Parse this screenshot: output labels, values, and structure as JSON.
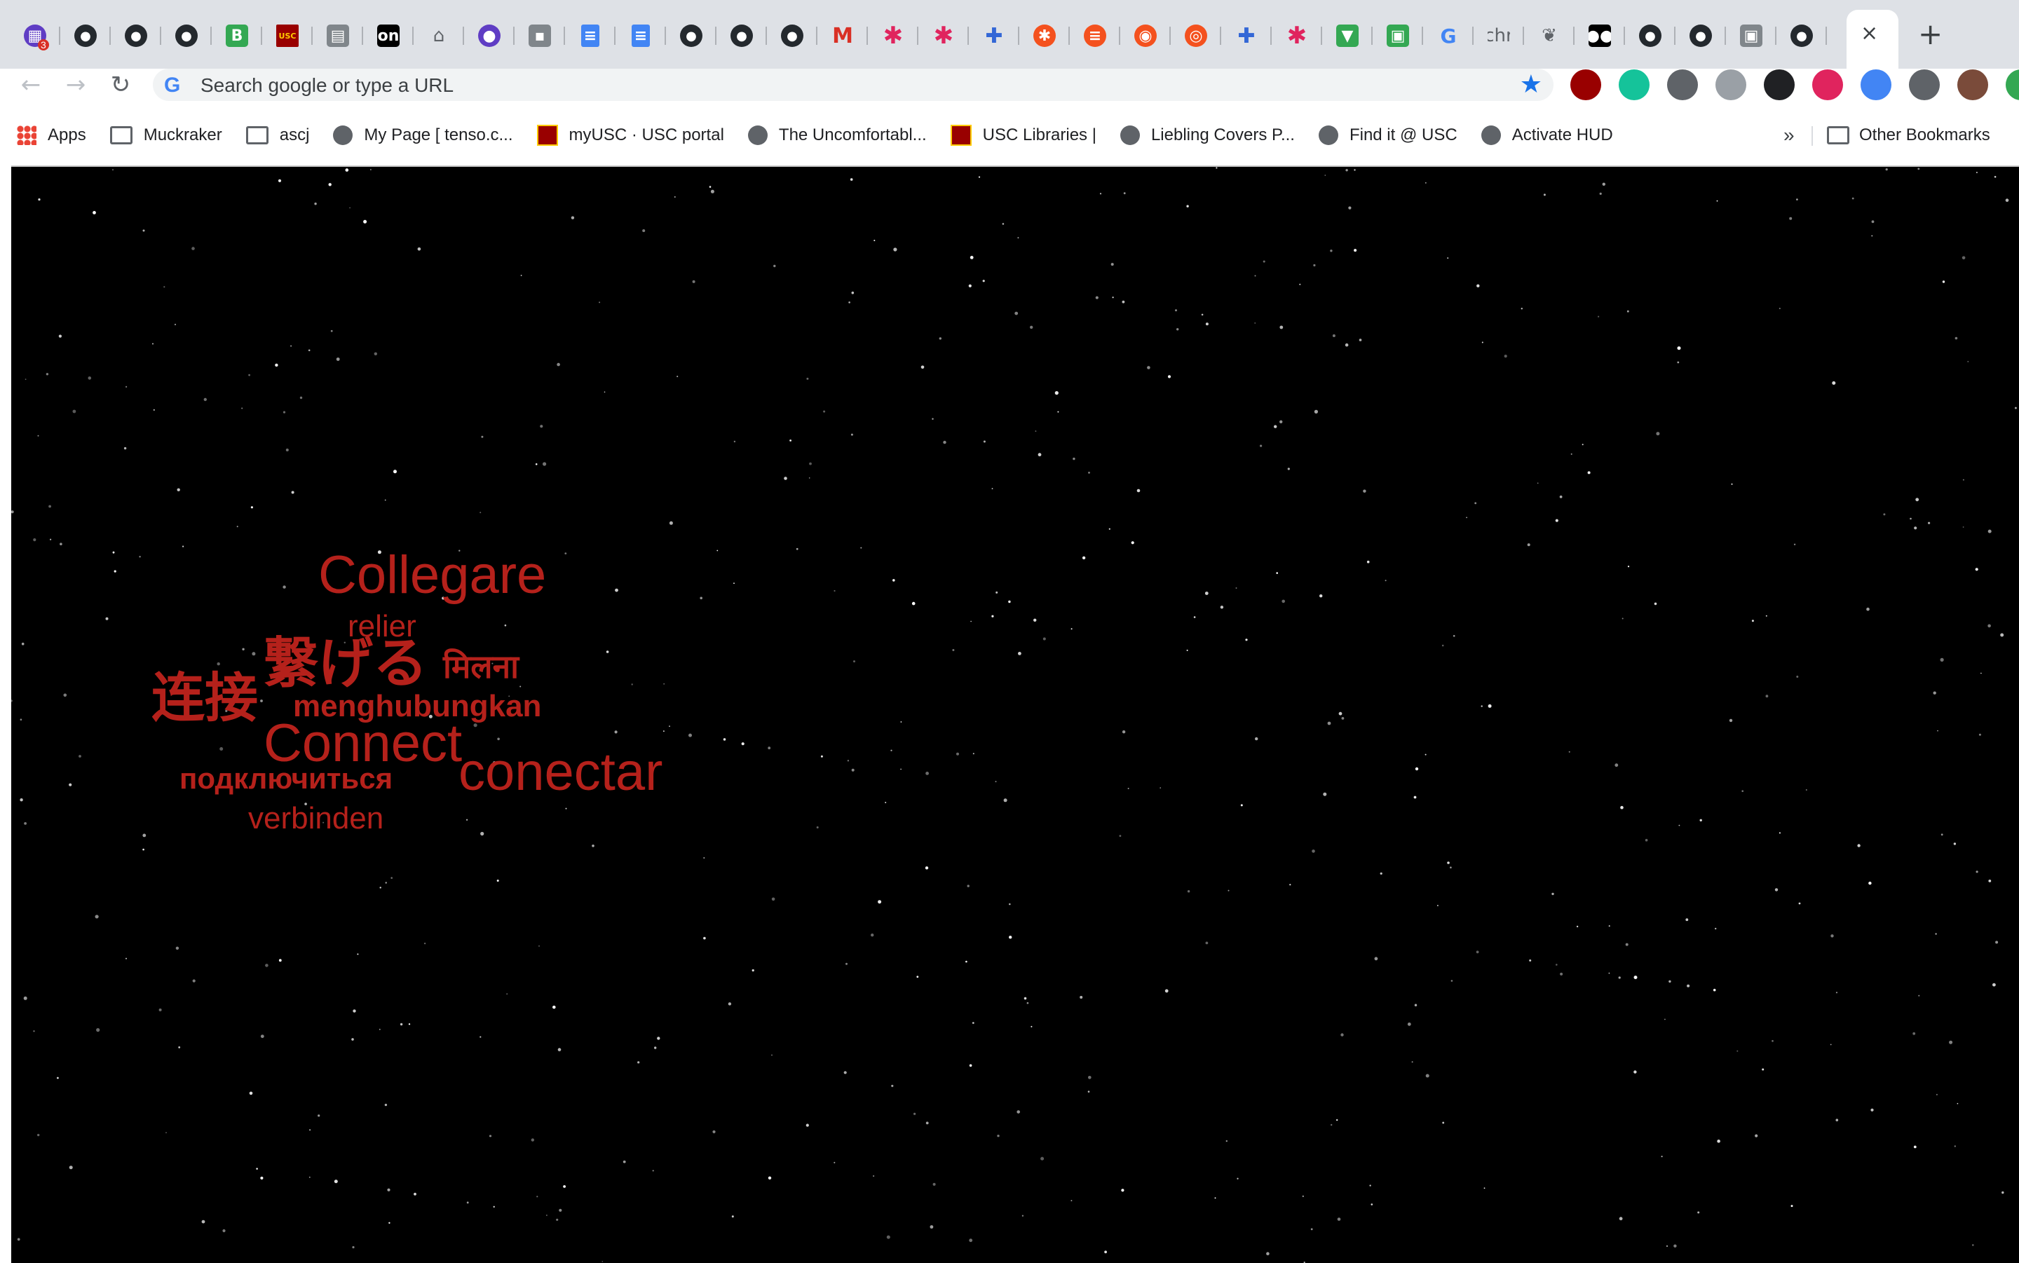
{
  "browser": {
    "tabs": [
      {
        "icon": "calendar-badge-icon",
        "badge": "3"
      },
      {
        "icon": "github-icon"
      },
      {
        "icon": "github-icon"
      },
      {
        "icon": "github-icon"
      },
      {
        "icon": "baylor-icon"
      },
      {
        "icon": "usc-icon"
      },
      {
        "icon": "puzzle-page-icon"
      },
      {
        "icon": "on-icon",
        "text": "on"
      },
      {
        "icon": "hat-icon"
      },
      {
        "icon": "circle-icon"
      },
      {
        "icon": "contact-card-icon"
      },
      {
        "icon": "google-docs-icon"
      },
      {
        "icon": "google-docs-icon"
      },
      {
        "icon": "github-icon"
      },
      {
        "icon": "github-icon"
      },
      {
        "icon": "github-icon"
      },
      {
        "icon": "gmail-icon"
      },
      {
        "icon": "asterisk-icon"
      },
      {
        "icon": "asterisk-icon"
      },
      {
        "icon": "puzzle-icon"
      },
      {
        "icon": "orange-asterisk-icon"
      },
      {
        "icon": "stack-overflow-icon"
      },
      {
        "icon": "record-icon"
      },
      {
        "icon": "chrome-icon"
      },
      {
        "icon": "puzzle-icon"
      },
      {
        "icon": "asterisk-icon"
      },
      {
        "icon": "vue-icon"
      },
      {
        "icon": "green-box-icon"
      },
      {
        "icon": "google-icon"
      },
      {
        "icon": "text-icon",
        "text": "chr"
      },
      {
        "icon": "wreath-icon"
      },
      {
        "icon": "medium-icon"
      },
      {
        "icon": "github-icon"
      },
      {
        "icon": "github-icon"
      },
      {
        "icon": "app-icon"
      },
      {
        "icon": "github-icon"
      }
    ],
    "active_tab": {
      "close_glyph": "×"
    },
    "new_tab_glyph": "+",
    "nav": {
      "back": "←",
      "forward": "→",
      "reload": "↻"
    },
    "omnibox": {
      "placeholder": "Search google or type a URL",
      "value": ""
    },
    "extensions": [
      "usc-shield-icon",
      "grammarly-icon",
      "mail-icon",
      "download-icon",
      "more-dots-icon",
      "m-icon",
      "feather-icon",
      "extensions-puzzle-icon",
      "profile-avatar",
      "update-icon"
    ],
    "bookmarks": [
      {
        "label": "Apps",
        "icon": "apps-icon"
      },
      {
        "label": "Muckraker",
        "icon": "folder-icon"
      },
      {
        "label": "ascj",
        "icon": "folder-icon"
      },
      {
        "label": "My Page [ tenso.c...",
        "icon": "globe-icon"
      },
      {
        "label": "myUSC · USC portal",
        "icon": "usc-icon"
      },
      {
        "label": "The Uncomfortabl...",
        "icon": "globe-icon"
      },
      {
        "label": "USC Libraries |",
        "icon": "usc-icon"
      },
      {
        "label": "Liebling Covers P...",
        "icon": "globe-icon"
      },
      {
        "label": "Find it @ USC",
        "icon": "globe-icon"
      },
      {
        "label": "Activate HUD",
        "icon": "globe-icon"
      }
    ],
    "bookmarks_more": "»",
    "other_bookmarks": "Other Bookmarks"
  },
  "page": {
    "background": "#000000",
    "word_color": "#b5211b",
    "words": [
      {
        "text": "Collegare"
      },
      {
        "text": "relier"
      },
      {
        "text": "繋げる"
      },
      {
        "text": "मिलना"
      },
      {
        "text": "连接"
      },
      {
        "text": "menghubungkan"
      },
      {
        "text": "Connect"
      },
      {
        "text": "conectar"
      },
      {
        "text": "подключиться"
      },
      {
        "text": "verbinden"
      }
    ]
  }
}
